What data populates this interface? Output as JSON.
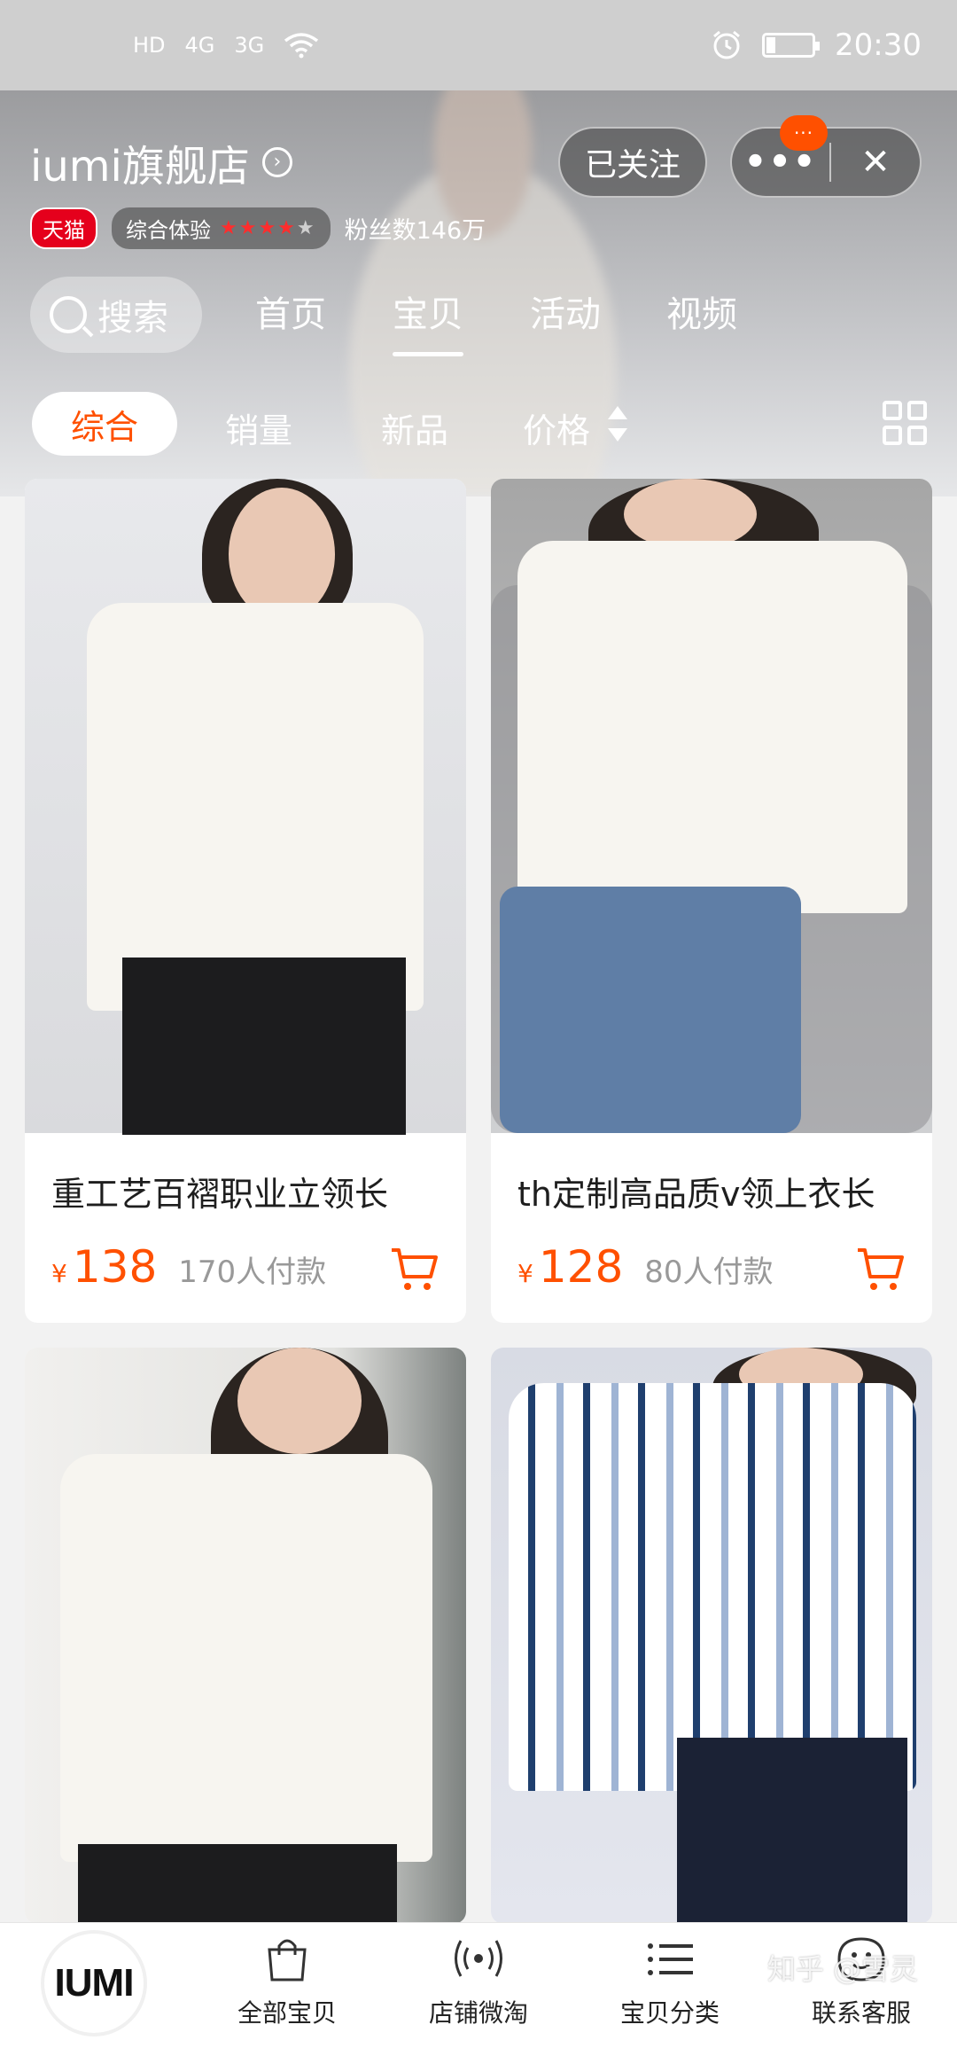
{
  "status_bar": {
    "left_indicators": [
      "HD",
      "4G",
      "3G"
    ],
    "time": "20:30"
  },
  "store": {
    "name": "iumi旗舰店",
    "follow_label": "已关注",
    "more_badge": "···",
    "tmall_tag": "天猫",
    "experience_label": "综合体验",
    "experience_stars": 4.5,
    "fans_label": "粉丝数146万"
  },
  "search": {
    "label": "搜索"
  },
  "nav_tabs": [
    {
      "label": "首页",
      "active": false
    },
    {
      "label": "宝贝",
      "active": true
    },
    {
      "label": "活动",
      "active": false
    },
    {
      "label": "视频",
      "active": false
    }
  ],
  "sort": {
    "items": [
      "综合",
      "销量",
      "新品",
      "价格"
    ],
    "active": "综合"
  },
  "products": [
    {
      "title": "重工艺百褶职业立领长",
      "currency": "¥",
      "price": "138",
      "sold": "170人付款"
    },
    {
      "title": "th定制高品质v领上衣长",
      "currency": "¥",
      "price": "128",
      "sold": "80人付款"
    },
    {
      "title": "",
      "currency": "",
      "price": "",
      "sold": ""
    },
    {
      "title": "",
      "currency": "",
      "price": "",
      "sold": ""
    }
  ],
  "bottom_tabs": {
    "logo": "IUMI",
    "items": [
      {
        "label": "全部宝贝",
        "icon": "shopping-bag-icon"
      },
      {
        "label": "店铺微淘",
        "icon": "broadcast-icon"
      },
      {
        "label": "宝贝分类",
        "icon": "list-icon"
      },
      {
        "label": "联系客服",
        "icon": "chat-face-icon"
      }
    ]
  },
  "watermark": "知乎 @雪灵",
  "colors": {
    "accent": "#ff5000",
    "tmall_red": "#e5001c"
  }
}
